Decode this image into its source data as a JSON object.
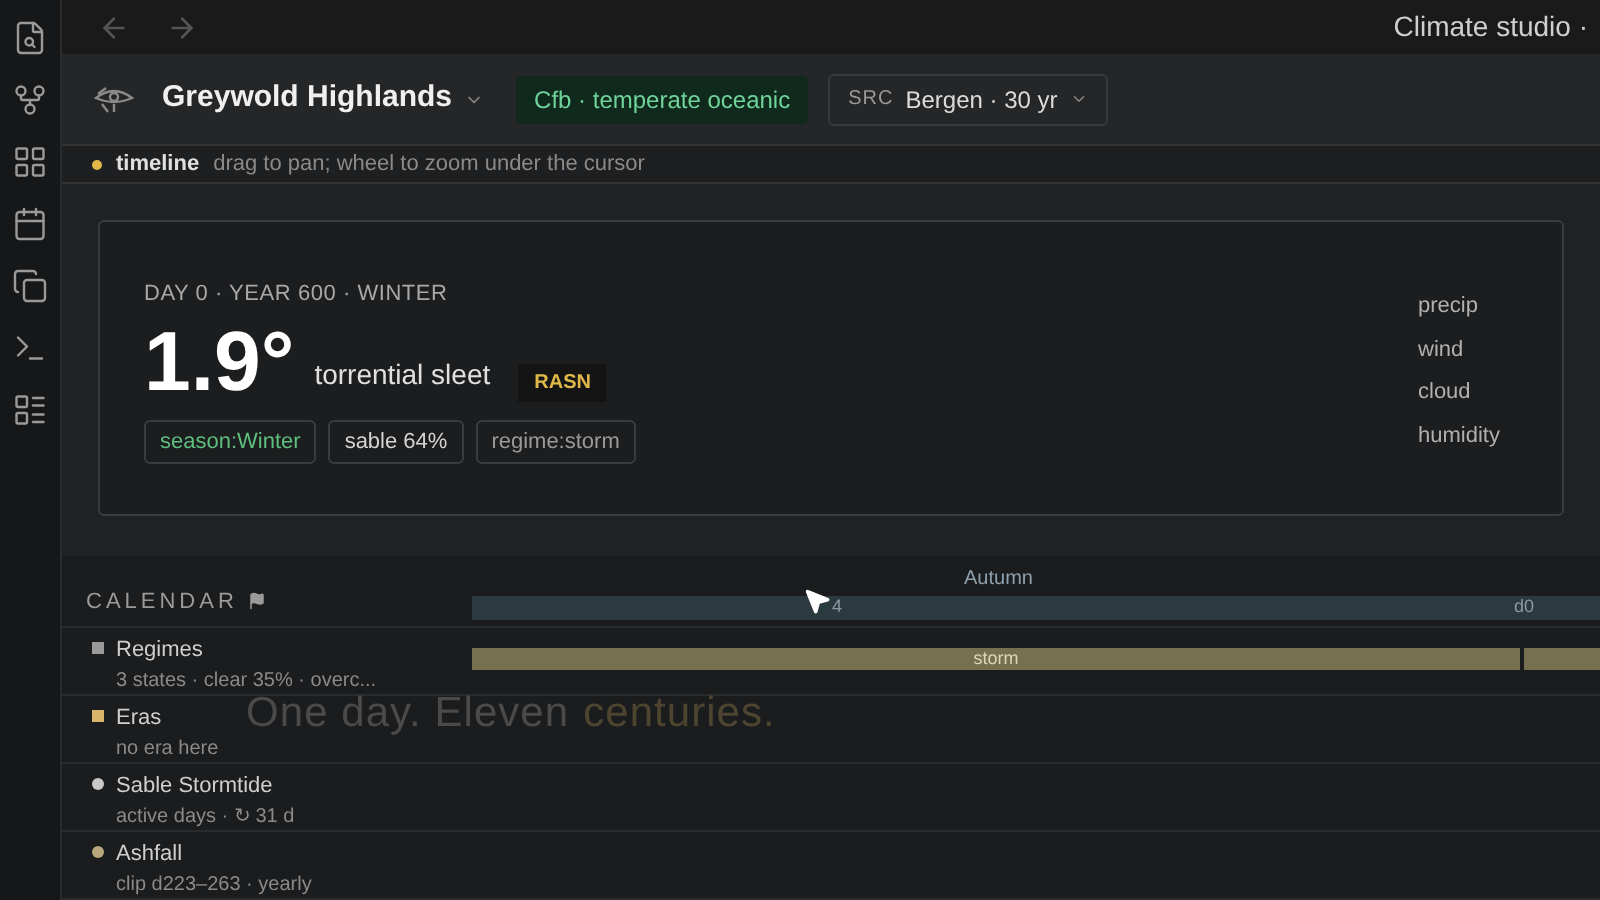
{
  "sidebar": {
    "items": [
      {
        "selected": false
      },
      {
        "selected": false
      },
      {
        "selected": false
      },
      {
        "selected": false
      },
      {
        "selected": false
      },
      {
        "selected": false
      },
      {
        "selected": false
      }
    ]
  },
  "top_bar": {
    "title": "Climate studio ·"
  },
  "header": {
    "place": "Greywold Highlands",
    "climate_badge": "Cfb · temperate oceanic",
    "source": {
      "label": "SRC",
      "value": "Bergen · 30 yr"
    }
  },
  "hint": {
    "color": "#e0b84a",
    "label": "timeline",
    "text": "drag to pan; wheel to zoom under the cursor"
  },
  "card": {
    "date": "DAY 0 · YEAR 600 · WINTER",
    "temperature": "1.9°",
    "condition": "torrential sleet",
    "code": "RASN",
    "tags": [
      {
        "text": "season:Winter",
        "color": "#5fbf7f"
      },
      {
        "text": "sable 64%",
        "color": "#d4d4d4"
      },
      {
        "text": "regime:storm",
        "color": "#9a9a9a"
      }
    ],
    "metrics": [
      "precip",
      "wind",
      "cloud",
      "humidity"
    ]
  },
  "calendar": {
    "title": "CALENDAR",
    "season_label": "Autumn",
    "ticks": [
      "4",
      "d0"
    ],
    "items": [
      {
        "name": "Regimes",
        "detail": "3 states · clear 35% · overc...",
        "kind": "square",
        "color": "#9a9a9a"
      },
      {
        "name": "Eras",
        "detail": "no era here",
        "kind": "square",
        "color": "#d8b56a"
      },
      {
        "name": "Sable Stormtide",
        "detail": "active days · ↻ 31 d",
        "kind": "circle",
        "color": "#c8c8c8"
      },
      {
        "name": "Ashfall",
        "detail": "clip d223–263 · yearly",
        "kind": "circle",
        "color": "#b7a77a"
      }
    ],
    "regime_bar": {
      "label": "storm"
    }
  },
  "overlay": {
    "parts": [
      {
        "text": "One day. Eleven",
        "color": "#4a4a4a"
      },
      {
        "text": "centuries.",
        "color": "#4e4530"
      }
    ]
  }
}
